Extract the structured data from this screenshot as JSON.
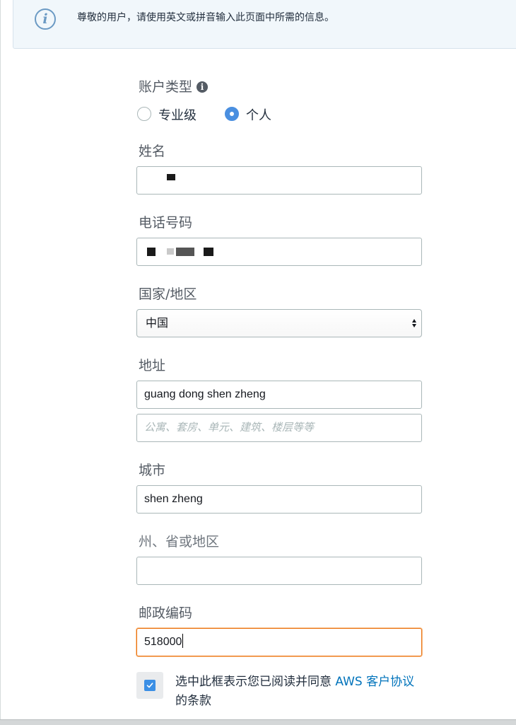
{
  "info_banner": {
    "icon": "info-icon",
    "text": "尊敬的用户，请使用英文或拼音输入此页面中所需的信息。"
  },
  "account_type": {
    "label": "账户类型",
    "options": [
      {
        "label": "专业级",
        "selected": false
      },
      {
        "label": "个人",
        "selected": true
      }
    ]
  },
  "name": {
    "label": "姓名",
    "value": ""
  },
  "phone": {
    "label": "电话号码",
    "value": ""
  },
  "country": {
    "label": "国家/地区",
    "selected": "中国"
  },
  "address": {
    "label": "地址",
    "line1": "guang dong shen zheng",
    "line2_placeholder": "公寓、套房、单元、建筑、楼层等等"
  },
  "city": {
    "label": "城市",
    "value": "shen zheng"
  },
  "state": {
    "label": "州、省或地区",
    "value": ""
  },
  "postal_code": {
    "label": "邮政编码",
    "value": "518000"
  },
  "agreement": {
    "checked": true,
    "text_before": "选中此框表示您已阅读并同意 ",
    "link": "AWS 客户协议",
    "text_after": "的条款"
  },
  "colors": {
    "accent": "#4a8fe0",
    "link": "#0073bb",
    "focus": "#ec7211",
    "info_bg": "#f1f7fb"
  }
}
